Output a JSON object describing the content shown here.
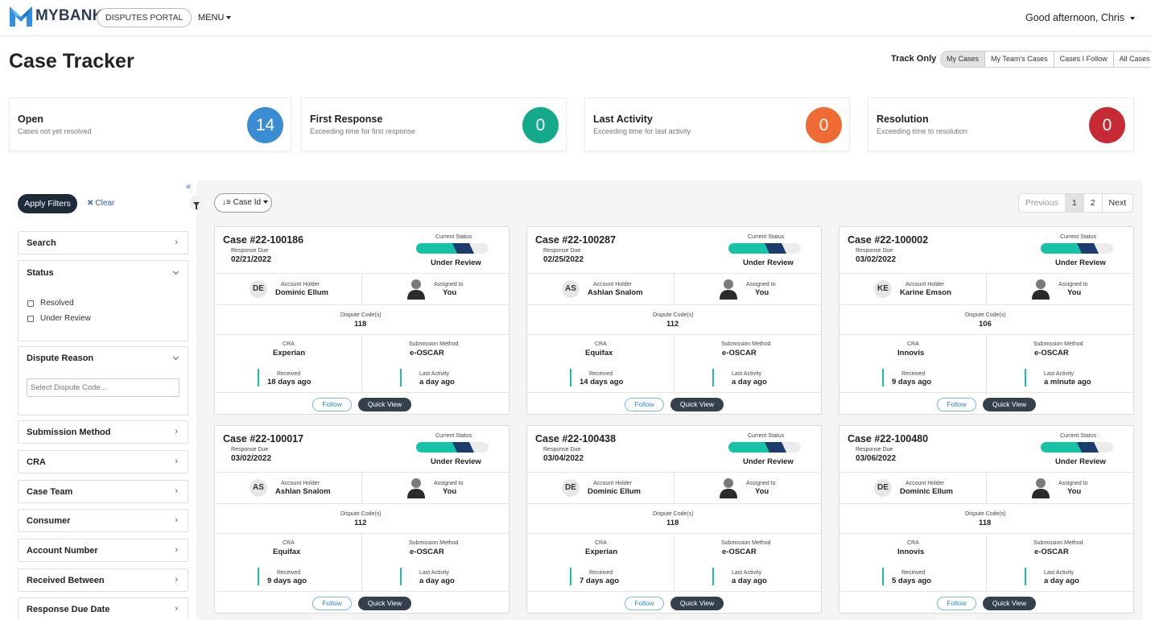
{
  "header": {
    "brand": "MYBANK",
    "portal": "DISPUTES PORTAL",
    "menu": "MENU",
    "greeting": "Good afternoon, Chris"
  },
  "page": {
    "title": "Case Tracker",
    "track_label": "Track Only",
    "track_options": [
      "My Cases",
      "My Team's Cases",
      "Cases I Follow",
      "All Cases"
    ],
    "track_selected": "My Cases"
  },
  "stats": [
    {
      "title": "Open",
      "subtitle": "Cases not yet resolved",
      "value": "14",
      "color": "#3a8dd2"
    },
    {
      "title": "First Response",
      "subtitle": "Exceeding time for first response",
      "value": "0",
      "color": "#14a98a"
    },
    {
      "title": "Last Activity",
      "subtitle": "Exceeding time for last activity",
      "value": "0",
      "color": "#f06a34"
    },
    {
      "title": "Resolution",
      "subtitle": "Exceeding time to resolution",
      "value": "0",
      "color": "#c62a35"
    }
  ],
  "filters": {
    "apply_label": "Apply Filters",
    "clear_label": "Clear",
    "search": "Search",
    "status": {
      "title": "Status",
      "options": [
        "Resolved",
        "Under Review"
      ]
    },
    "dispute_reason": {
      "title": "Dispute Reason",
      "placeholder": "Select Dispute Code..."
    },
    "submission_method": "Submission Method",
    "cra": "CRA",
    "case_team": "Case Team",
    "consumer": "Consumer",
    "account_number": "Account Number",
    "received_between": "Received Between",
    "response_due_date": "Response Due Date"
  },
  "toolbar": {
    "sort_label": "Case Id",
    "pager": {
      "previous": "Previous",
      "pages": [
        "1",
        "2"
      ],
      "current": "1",
      "next": "Next"
    }
  },
  "card_labels": {
    "response_due": "Response Due",
    "current_status": "Current Status",
    "account_holder": "Account Holder",
    "assigned_to": "Assigned to",
    "dispute_codes": "Dispute Code(s)",
    "cra": "CRA",
    "submission_method": "Submission Method",
    "received": "Received",
    "last_activity": "Last Activity",
    "follow": "Follow",
    "quick_view": "Quick View"
  },
  "status_colors": {
    "complete": "#17c3a6",
    "current": "#1d3c6e",
    "pending": "#ececec"
  },
  "cases": [
    {
      "title": "Case #22-100186",
      "due": "02/21/2022",
      "status": "Under Review",
      "initials": "DE",
      "holder": "Dominic Ellum",
      "assigned": "You",
      "code": "118",
      "cra": "Experian",
      "method": "e-OSCAR",
      "received": "18 days ago",
      "activity": "a day ago"
    },
    {
      "title": "Case #22-100287",
      "due": "02/25/2022",
      "status": "Under Review",
      "initials": "AS",
      "holder": "Ashlan Snalom",
      "assigned": "You",
      "code": "112",
      "cra": "Equifax",
      "method": "e-OSCAR",
      "received": "14 days ago",
      "activity": "a day ago"
    },
    {
      "title": "Case #22-100002",
      "due": "03/02/2022",
      "status": "Under Review",
      "initials": "KE",
      "holder": "Karine Emson",
      "assigned": "You",
      "code": "106",
      "cra": "Innovis",
      "method": "e-OSCAR",
      "received": "9 days ago",
      "activity": "a minute ago"
    },
    {
      "title": "Case #22-100017",
      "due": "03/02/2022",
      "status": "Under Review",
      "initials": "AS",
      "holder": "Ashlan Snalom",
      "assigned": "You",
      "code": "112",
      "cra": "Equifax",
      "method": "e-OSCAR",
      "received": "9 days ago",
      "activity": "a day ago"
    },
    {
      "title": "Case #22-100438",
      "due": "03/04/2022",
      "status": "Under Review",
      "initials": "DE",
      "holder": "Dominic Ellum",
      "assigned": "You",
      "code": "118",
      "cra": "Experian",
      "method": "e-OSCAR",
      "received": "7 days ago",
      "activity": "a day ago"
    },
    {
      "title": "Case #22-100480",
      "due": "03/06/2022",
      "status": "Under Review",
      "initials": "DE",
      "holder": "Dominic Ellum",
      "assigned": "You",
      "code": "118",
      "cra": "Innovis",
      "method": "e-OSCAR",
      "received": "5 days ago",
      "activity": "a day ago"
    }
  ]
}
